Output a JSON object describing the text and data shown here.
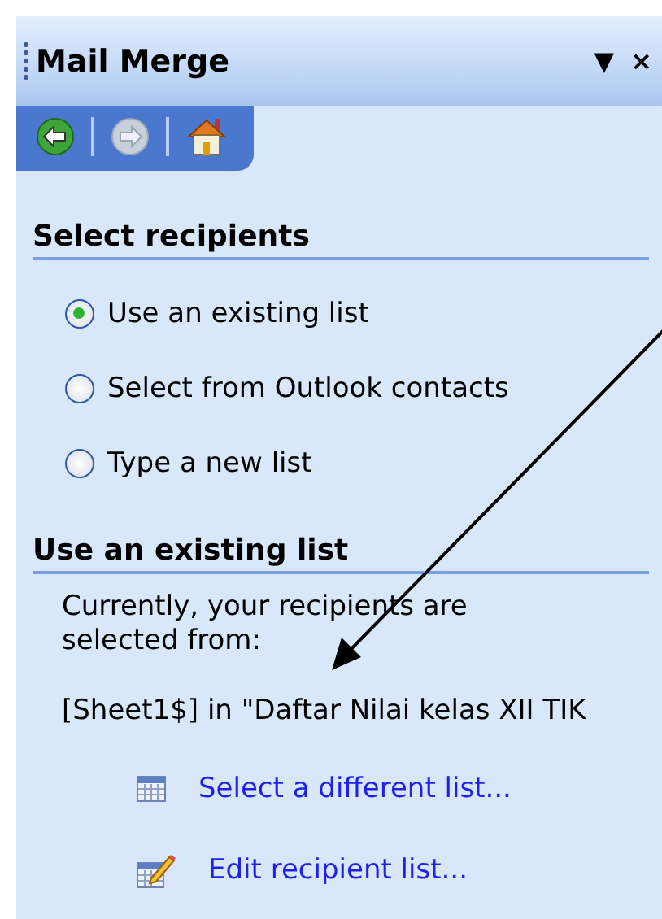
{
  "pane": {
    "title": "Mail Merge",
    "menu_glyph": "▼",
    "close_glyph": "×"
  },
  "nav": [
    {
      "kind": "back",
      "disabled": false
    },
    {
      "kind": "forward",
      "disabled": true
    },
    {
      "kind": "home",
      "disabled": false
    }
  ],
  "sections": [
    {
      "heading": "Select recipients",
      "kind": "options",
      "options": [
        {
          "label": "Use an existing list",
          "selected": true
        },
        {
          "label": "Select from Outlook contacts",
          "selected": false
        },
        {
          "label": "Type a new list",
          "selected": false
        }
      ]
    },
    {
      "heading": "Use an existing list",
      "kind": "source",
      "text": "Currently, your recipients are selected from:",
      "source": "[Sheet1$] in \"Daftar Nilai kelas XII TIK",
      "links": [
        {
          "label": "Select a different list...",
          "kind": "table"
        },
        {
          "label": "Edit recipient list...",
          "kind": "edit"
        }
      ]
    }
  ]
}
